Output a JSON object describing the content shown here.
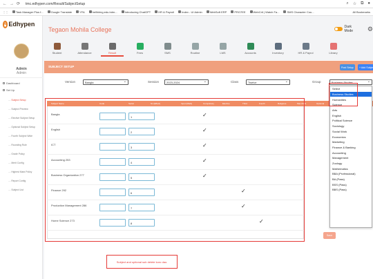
{
  "browser": {
    "url": "tmc.edhypen.com/Result/SubjectSetup",
    "all_bookmarks": "All Bookmarks"
  },
  "bookmarks": [
    "Task Manager Plus f...",
    "Google Translate",
    "YFA",
    "hellhiring.edu.bdm...",
    "Introducing ChatGPT",
    "HR & Payroll",
    "Index - UI Admin",
    "WebSoft ERP",
    "PRO7EE",
    "WebCrit | Watch Fa...",
    "SMS Character Cou..."
  ],
  "sidebar": {
    "brand": "Edhypen",
    "brand_mark": "e",
    "user_name": "Admin",
    "user_role": "Admin",
    "dashboard": "Dashboard",
    "setup": "Set Up",
    "items": [
      "Subject Setup",
      "Subject Preview",
      "Elective Subject Setup",
      "Optional Subject Setup",
      "Fourth Subject Wide",
      "Rounding Rule",
      "Grade Policy",
      "Merit Config",
      "Highest Mark Policy",
      "Report Config",
      "Subject List"
    ]
  },
  "header": {
    "school": "Tegaon Mohila College",
    "dark_mode": "Dark Mode"
  },
  "tabs": [
    {
      "label": "Student",
      "color": "#8e5a3b"
    },
    {
      "label": "Attendance",
      "color": "#777777"
    },
    {
      "label": "Result",
      "color": "#6b6b6b"
    },
    {
      "label": "Fees",
      "color": "#27ae60"
    },
    {
      "label": "SMS",
      "color": "#7f8c8d"
    },
    {
      "label": "Routine",
      "color": "#95a5a6"
    },
    {
      "label": "LMS",
      "color": "#95a5a6"
    },
    {
      "label": "Accounts",
      "color": "#2e8b57"
    },
    {
      "label": "Inventory",
      "color": "#5d6d7e"
    },
    {
      "label": "HR & Payrol",
      "color": "#6c7a89"
    },
    {
      "label": "Library",
      "color": "#e57373"
    }
  ],
  "panel": {
    "title": "SUBJECT SETUP",
    "setup_btn": "Post Setup",
    "add_btn": "+ Add Subject",
    "version_label": "Version",
    "version_value": "Bangla",
    "session_label": "Session",
    "session_value": "2023-2024",
    "class_label": "Class",
    "class_value": "Twelve",
    "group_label": "Group",
    "group_value": "Business Studies"
  },
  "table": {
    "headers": [
      "Subject Name",
      "Code",
      "Serial",
      "Sn (Effect)",
      "Input (Mark)",
      "Compulsory",
      "Elective",
      "Third",
      "Fourth",
      "Religious",
      "Max Mark",
      "Optional"
    ],
    "rows": [
      {
        "name": "Bangla",
        "serial": "1"
      },
      {
        "name": "English",
        "serial": "2"
      },
      {
        "name": "ICT",
        "serial": "3"
      },
      {
        "name": "Accounting 253",
        "serial": "4"
      },
      {
        "name": "Business Organization 277",
        "serial": "5"
      },
      {
        "name": "Finance 292",
        "serial": "6"
      },
      {
        "name": "Production Management 286",
        "serial": "7"
      },
      {
        "name": "Home Science 273",
        "serial": "8"
      }
    ]
  },
  "save": "Save",
  "note": "Subject and optional sub delete koro dao.",
  "group_options": [
    "Select",
    "Business Studies",
    "Humanities",
    "Science",
    "Arts",
    "English",
    "Political Science",
    "Sociology",
    "Social Work",
    "Economics",
    "Marketing",
    "Finance & Banking",
    "Accounting",
    "Management",
    "Zoology",
    "Mathematics",
    "BBA (Professional)",
    "BA (Pass)",
    "BSS (Pass)",
    "BBS (Pass)"
  ]
}
